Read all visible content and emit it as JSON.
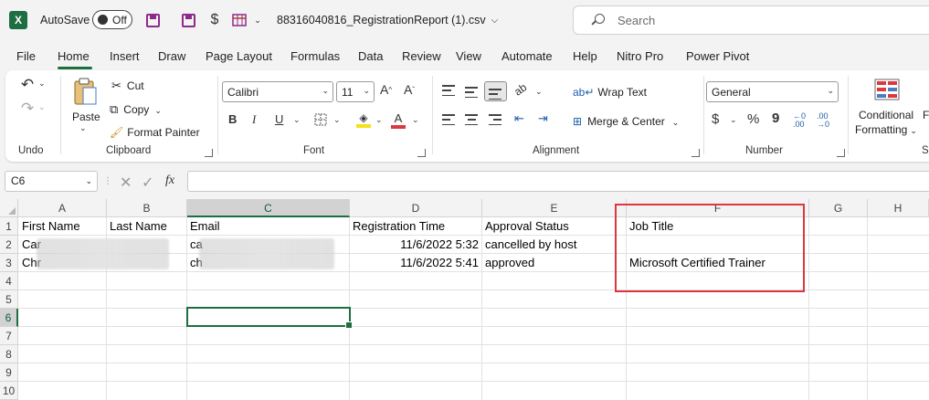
{
  "titlebar": {
    "app_icon": "X",
    "autosave_label": "AutoSave",
    "autosave_state": "Off",
    "filename": "88316040816_RegistrationReport (1).csv",
    "search_placeholder": "Search"
  },
  "menu": {
    "tabs": [
      "File",
      "Home",
      "Insert",
      "Draw",
      "Page Layout",
      "Formulas",
      "Data",
      "Review",
      "View",
      "Automate",
      "Help",
      "Nitro Pro",
      "Power Pivot"
    ],
    "active": "Home"
  },
  "ribbon": {
    "undo": {
      "group_label": "Undo"
    },
    "clipboard": {
      "paste": "Paste",
      "cut": "Cut",
      "copy": "Copy",
      "format_painter": "Format Painter",
      "group_label": "Clipboard"
    },
    "font": {
      "font_name": "Calibri",
      "font_size": "11",
      "bold": "B",
      "italic": "I",
      "underline": "U",
      "group_label": "Font"
    },
    "alignment": {
      "wrap_text": "Wrap Text",
      "merge_center": "Merge & Center",
      "group_label": "Alignment"
    },
    "number": {
      "format": "General",
      "currency": "$",
      "percent": "%",
      "comma": "9",
      "group_label": "Number"
    },
    "styles": {
      "conditional_formatting_line1": "Conditional",
      "conditional_formatting_line2": "Formatting",
      "group_label_partial": "S"
    }
  },
  "formula_bar": {
    "name_box": "C6",
    "fx": "fx",
    "content": ""
  },
  "sheet": {
    "columns": [
      "A",
      "B",
      "C",
      "D",
      "E",
      "F",
      "G",
      "H"
    ],
    "selected_column": "C",
    "rows": [
      "1",
      "2",
      "3",
      "4",
      "5",
      "6",
      "7",
      "8",
      "9",
      "10"
    ],
    "selected_row": "6",
    "header_row": {
      "a": "First Name",
      "b": "Last Name",
      "c": "Email",
      "d": "Registration Time",
      "e": "Approval Status",
      "f": "Job Title"
    },
    "row2": {
      "a": "Car",
      "c": "ca",
      "d": "11/6/2022 5:32",
      "e": "cancelled by host",
      "f": ""
    },
    "row3": {
      "a": "Chr",
      "c": "ch",
      "d": "11/6/2022 5:41",
      "e": "approved",
      "f": "Microsoft Certified Trainer"
    },
    "active_cell": "C6",
    "highlight_color": "#d9393f"
  },
  "colors": {
    "accent": "#1d6f42",
    "highlight": "#d9393f"
  }
}
